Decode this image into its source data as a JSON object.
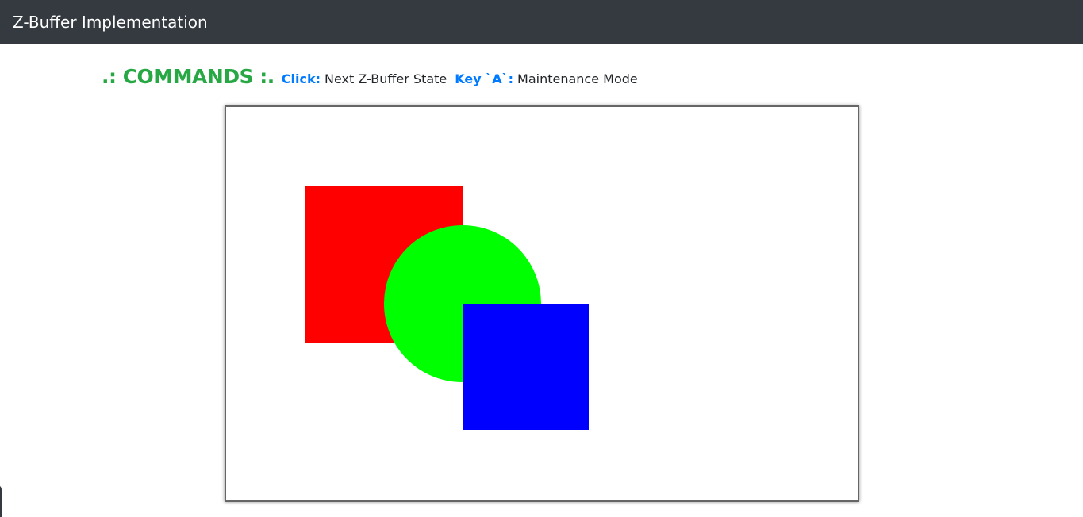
{
  "navbar": {
    "title": "Z-Buffer Implementation"
  },
  "commands": {
    "heading": ".: COMMANDS :.",
    "items": [
      {
        "key": "Click:",
        "action": "Next Z-Buffer State"
      },
      {
        "key": "Key `A`:",
        "action": "Maintenance Mode"
      }
    ]
  },
  "scene": {
    "background": "#ffffff",
    "shapes": [
      {
        "name": "red-square",
        "kind": "square",
        "color": "#ff0000"
      },
      {
        "name": "green-circle",
        "kind": "circle",
        "color": "#00ff00"
      },
      {
        "name": "blue-square",
        "kind": "square",
        "color": "#0000ff"
      }
    ]
  }
}
